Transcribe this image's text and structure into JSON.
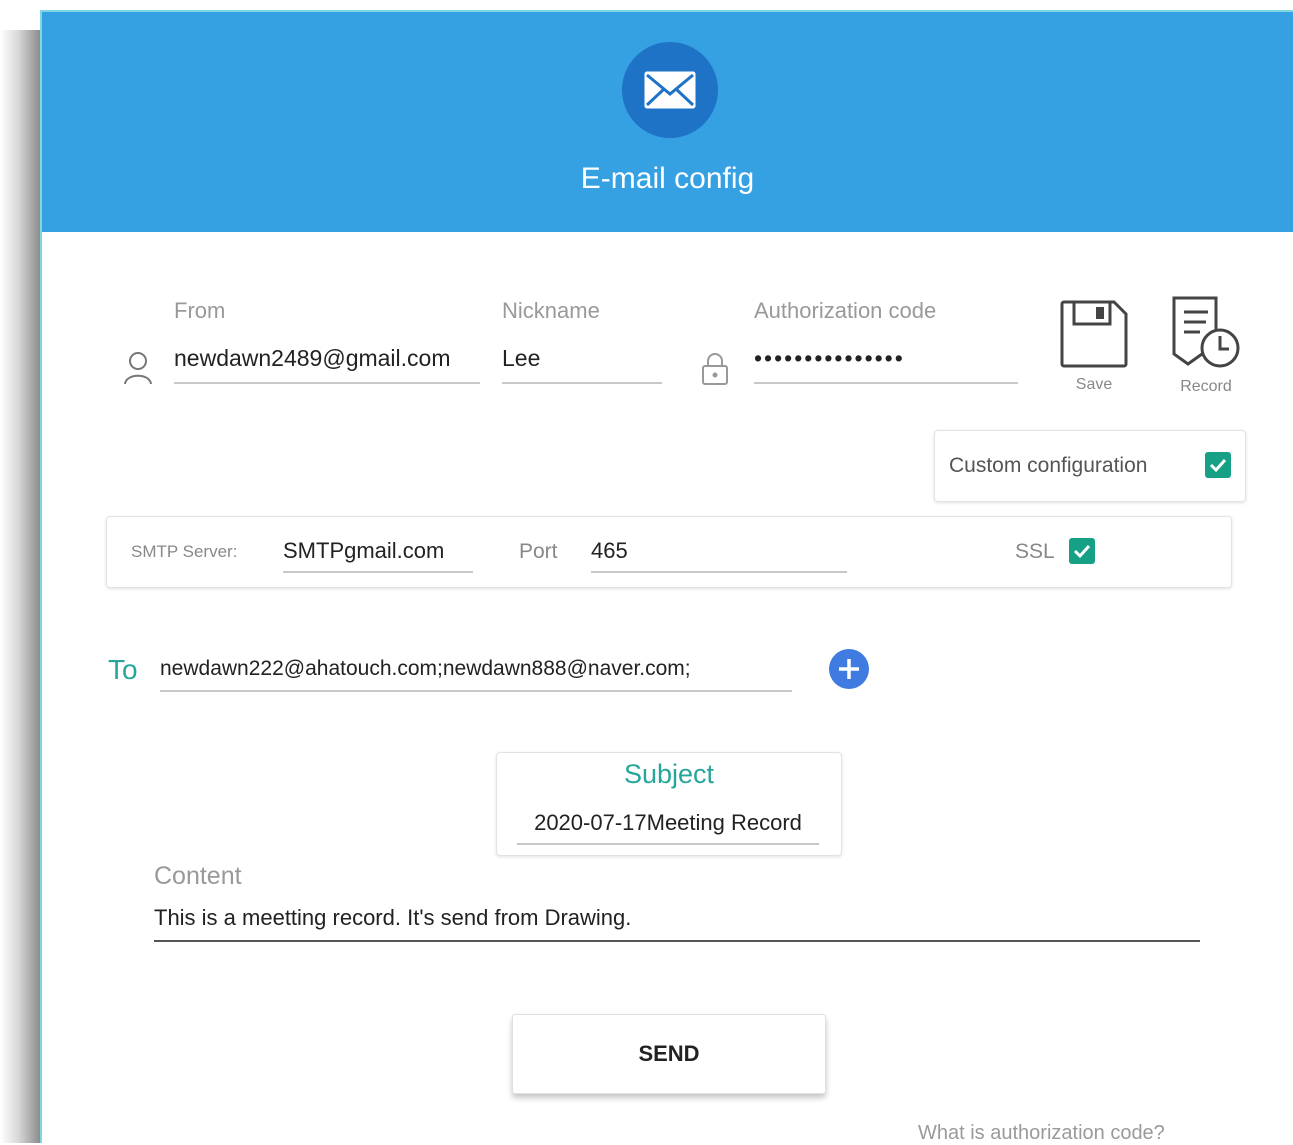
{
  "header": {
    "title": "E-mail config",
    "icon": "mail-icon",
    "background": "#35a1e3",
    "icon_circle": "#1e73c6"
  },
  "sender": {
    "from_label": "From",
    "from_value": "newdawn2489@gmail.com",
    "nickname_label": "Nickname",
    "nickname_value": "Lee",
    "auth_label": "Authorization code",
    "auth_value": "•••••••••••••••",
    "save_label": "Save",
    "record_label": "Record"
  },
  "custom_config": {
    "label": "Custom configuration",
    "checked": true
  },
  "smtp": {
    "server_label": "SMTP Server:",
    "server_value": "SMTPgmail.com",
    "port_label": "Port",
    "port_value": "465",
    "ssl_label": "SSL",
    "ssl_checked": true
  },
  "recipients": {
    "to_label": "To",
    "to_value": "newdawn222@ahatouch.com;newdawn888@naver.com;"
  },
  "subject": {
    "label": "Subject",
    "value": "2020-07-17Meeting Record"
  },
  "content": {
    "label": "Content",
    "value": "This is a meetting record. It's send from Drawing."
  },
  "actions": {
    "send_label": "SEND",
    "help_link": "What is authorization code?"
  },
  "colors": {
    "accent_teal": "#26a69a",
    "checkbox": "#16a085",
    "add_button": "#3f7be0"
  }
}
